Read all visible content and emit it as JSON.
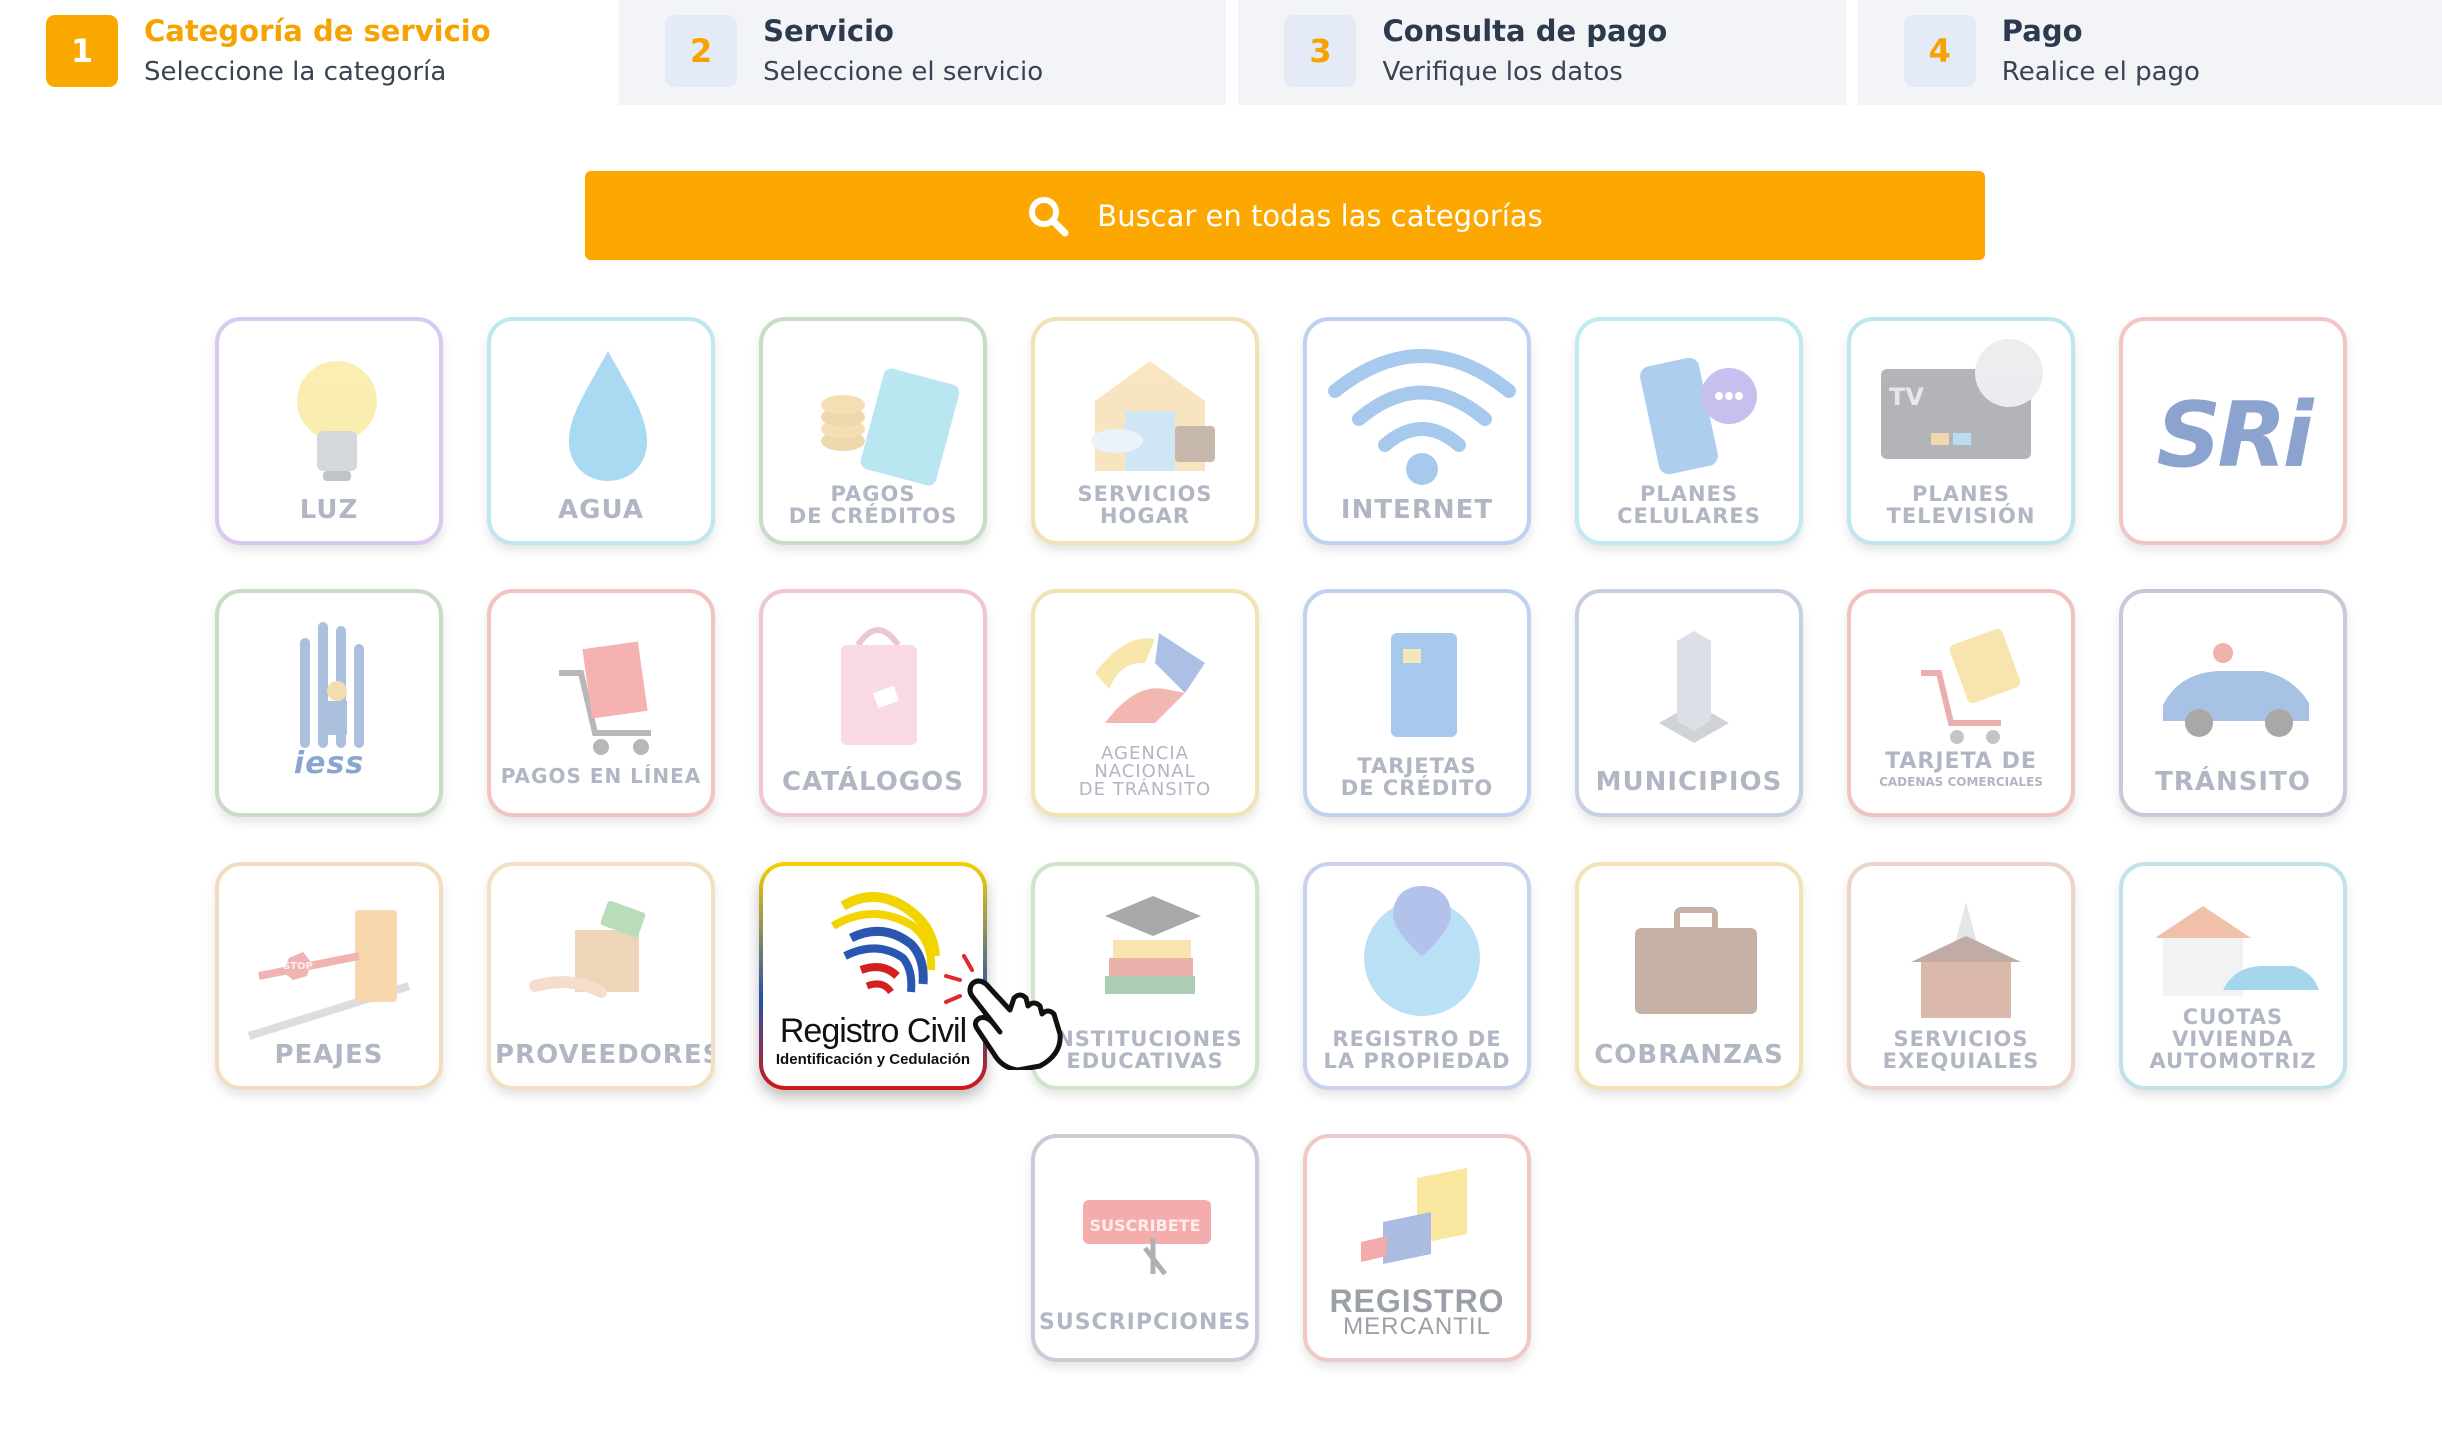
{
  "steps": [
    {
      "num": "1",
      "title": "Categoría de servicio",
      "subtitle": "Seleccione la categoría",
      "active": true
    },
    {
      "num": "2",
      "title": "Servicio",
      "subtitle": "Seleccione el servicio",
      "active": false
    },
    {
      "num": "3",
      "title": "Consulta de pago",
      "subtitle": "Verifique los datos",
      "active": false
    },
    {
      "num": "4",
      "title": "Pago",
      "subtitle": "Realice el pago",
      "active": false
    }
  ],
  "search": {
    "placeholder": "Buscar en todas las categorías"
  },
  "categories": {
    "luz": "LUZ",
    "agua": "AGUA",
    "pagos_creditos": "PAGOS\nDE CRÉDITOS",
    "servicios_hogar": "SERVICIOS\nHOGAR",
    "internet": "INTERNET",
    "planes_celulares": "PLANES\nCELULARES",
    "planes_television": "PLANES\nTELEVISIÓN",
    "tv_badge": "TV",
    "sri": "SRi",
    "iess": "iess",
    "pagos_linea": "PAGOS EN LÍNEA",
    "catalogos": "CATÁLOGOS",
    "ant": "AGENCIA\nNACIONAL\nDE TRÁNSITO",
    "tarjetas_credito": "TARJETAS\nDE CRÉDITO",
    "municipios": "MUNICIPIOS",
    "tarjeta_cadenas": "TARJETA DE",
    "tarjeta_cadenas_sub": "CADENAS COMERCIALES",
    "transito": "TRÁNSITO",
    "peajes": "PEAJES",
    "stop": "STOP",
    "proveedores": "PROVEEDORES",
    "registro_civil_title": "Registro Civil",
    "registro_civil_sub": "Identificación y Cedulación",
    "instituciones": "INSTITUCIONES\nEDUCATIVAS",
    "registro_propiedad": "REGISTRO DE\nLA PROPIEDAD",
    "cobranzas": "COBRANZAS",
    "servicios_exequiales": "SERVICIOS\nEXEQUIALES",
    "cuotas": "CUOTAS VIVIENDA\nAUTOMOTRIZ",
    "suscripciones": "SUSCRIPCIONES",
    "suscribete": "SUSCRIBETE",
    "registro_mercantil_1": "REGISTRO",
    "registro_mercantil_2": "MERCANTIL"
  },
  "colors": {
    "accent": "#fca800",
    "step_inactive_bg": "#f2f4f8",
    "label_gray": "#b0b6c3"
  }
}
